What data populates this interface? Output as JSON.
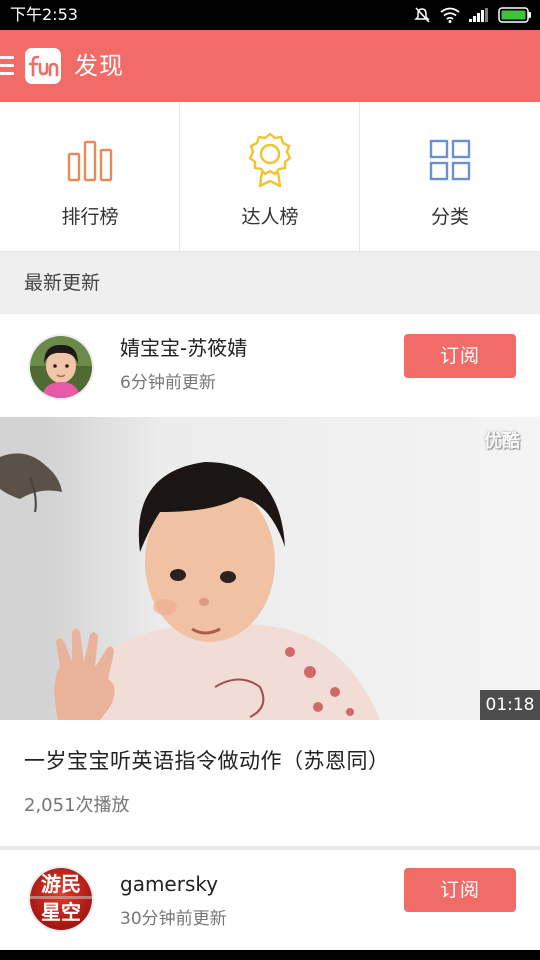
{
  "status_bar": {
    "time": "下午2:53",
    "icons": [
      "mute-icon",
      "wifi-icon",
      "signal-icon",
      "battery-icon"
    ]
  },
  "app_bar": {
    "logo_text": "fun",
    "title": "发现",
    "color": "#f16b67"
  },
  "categories": [
    {
      "label": "排行榜",
      "icon": "ranking-chart-icon",
      "color": "#e8895a"
    },
    {
      "label": "达人榜",
      "icon": "medal-icon",
      "color": "#f2c230"
    },
    {
      "label": "分类",
      "icon": "grid-category-icon",
      "color": "#6b8fd0"
    }
  ],
  "section": {
    "title": "最新更新"
  },
  "feed": [
    {
      "channel_name": "婧宝宝-苏筱婧",
      "updated": "6分钟前更新",
      "subscribe_label": "订阅",
      "video": {
        "duration": "01:18",
        "watermark": "优酷",
        "title": "一岁宝宝听英语指令做动作（苏恩同）",
        "plays": "2,051次播放"
      }
    },
    {
      "channel_name": "gamersky",
      "updated": "30分钟前更新",
      "subscribe_label": "订阅",
      "avatar_text": [
        "游民",
        "星空"
      ]
    }
  ]
}
